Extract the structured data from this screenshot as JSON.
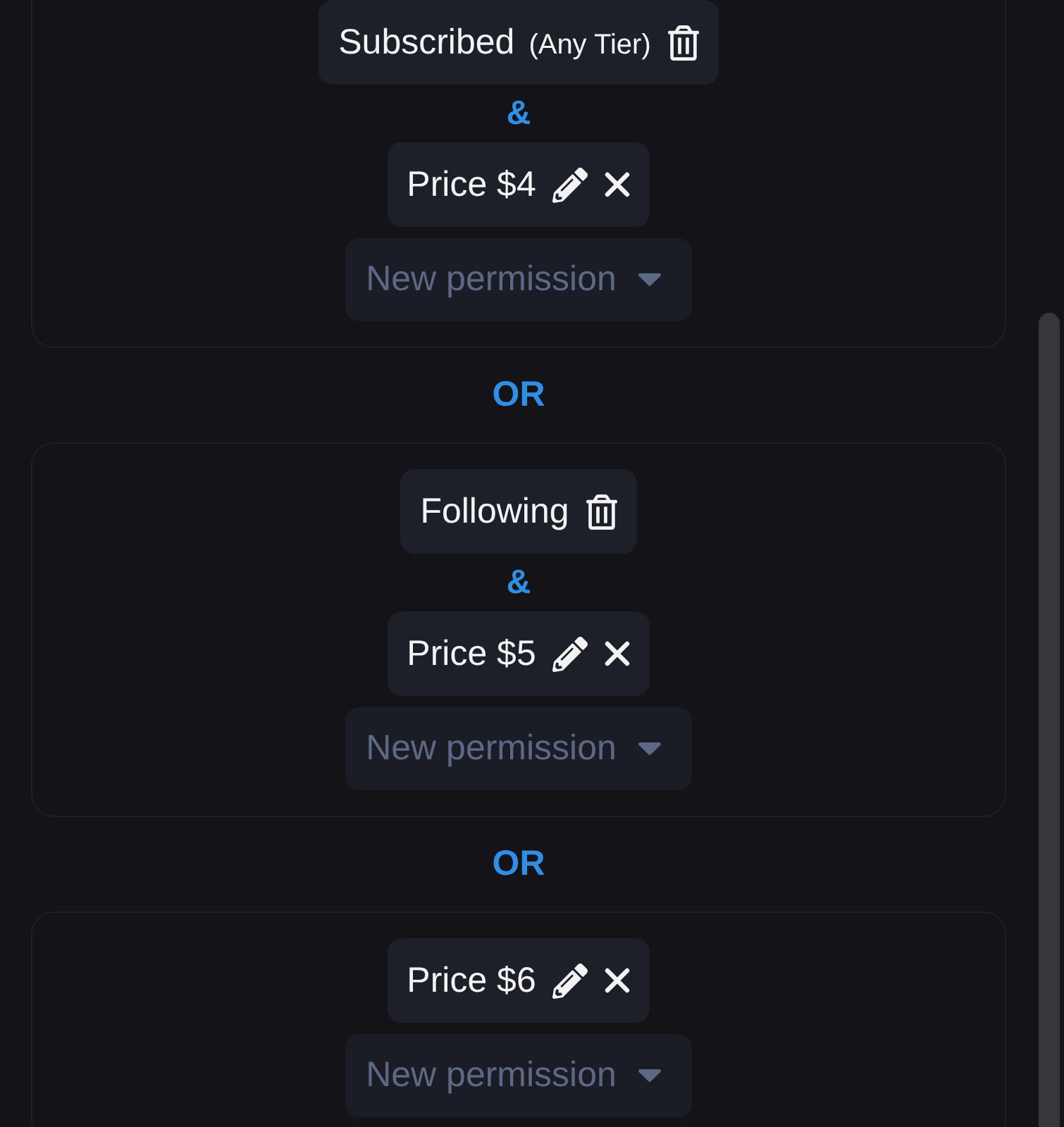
{
  "permission_rules": [
    {
      "kind": "group",
      "items": [
        {
          "kind": "membership",
          "label": "Subscribed",
          "note": "(Any Tier)"
        },
        {
          "kind": "joiner",
          "text": "&"
        },
        {
          "kind": "price",
          "label": "Price $4"
        }
      ],
      "new_permission": {
        "placeholder": "New permission"
      }
    },
    {
      "kind": "separator",
      "text": "OR"
    },
    {
      "kind": "group",
      "items": [
        {
          "kind": "membership",
          "label": "Following"
        },
        {
          "kind": "joiner",
          "text": "&"
        },
        {
          "kind": "price",
          "label": "Price $5"
        }
      ],
      "new_permission": {
        "placeholder": "New permission"
      }
    },
    {
      "kind": "separator",
      "text": "OR"
    },
    {
      "kind": "group",
      "items": [
        {
          "kind": "price",
          "label": "Price $6"
        }
      ],
      "new_permission": {
        "placeholder": "New permission"
      }
    }
  ]
}
